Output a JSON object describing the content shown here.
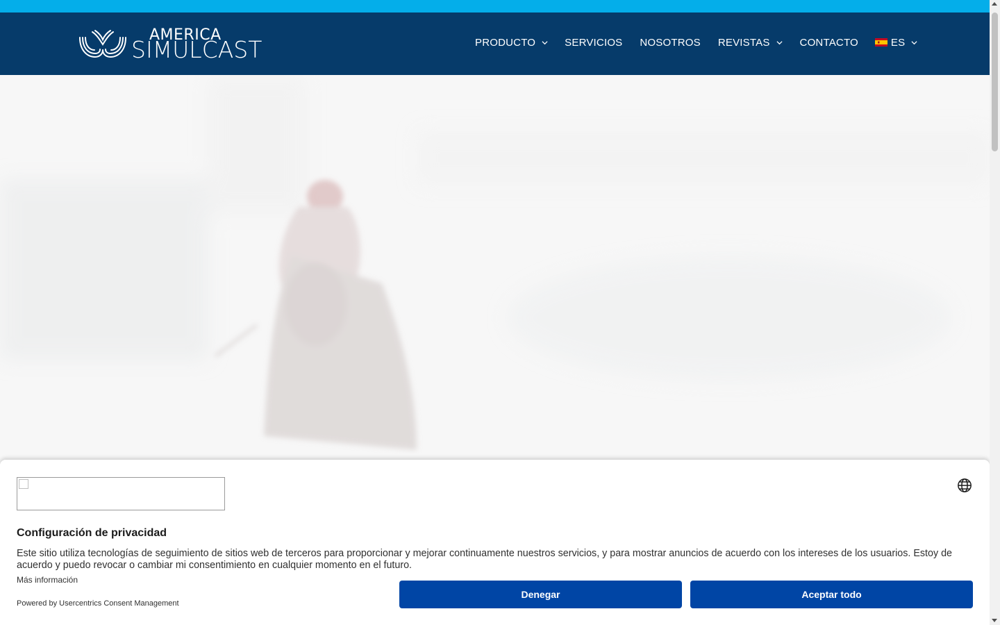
{
  "header": {
    "logo_top": "AMERICA",
    "logo_bottom": "SIMULCAST",
    "nav": [
      {
        "label": "PRODUCTO",
        "has_dropdown": true
      },
      {
        "label": "SERVICIOS",
        "has_dropdown": false
      },
      {
        "label": "NOSOTROS",
        "has_dropdown": false
      },
      {
        "label": "REVISTAS",
        "has_dropdown": true
      },
      {
        "label": "CONTACTO",
        "has_dropdown": false
      }
    ],
    "language": {
      "code": "ES",
      "flag": "spain-flag-icon"
    }
  },
  "colors": {
    "top_strip": "#04aeea",
    "navbar": "#063b6a",
    "button": "#0045a5"
  },
  "consent": {
    "title": "Configuración de privacidad",
    "text": "Este sitio utiliza tecnologías de seguimiento de sitios web de terceros para proporcionar y mejorar continuamente nuestros servicios, y para mostrar anuncios de acuerdo con los intereses de los usuarios. Estoy de acuerdo y puedo revocar o cambiar mi consentimiento en cualquier momento en el futuro.",
    "more_info": "Más información",
    "powered_by": "Powered by Usercentrics Consent Management",
    "deny_label": "Denegar",
    "accept_label": "Aceptar todo"
  }
}
